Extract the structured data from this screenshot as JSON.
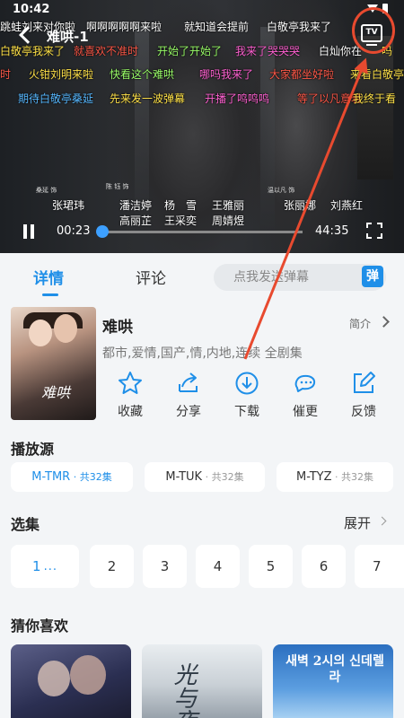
{
  "status_bar": {
    "time": "10:42"
  },
  "player": {
    "title": "难哄-1",
    "tv_label": "TV",
    "current_time": "00:23",
    "total_time": "44:35",
    "progress": 0.0086,
    "danmaku": [
      {
        "text": "跳蛙刘来对你啦",
        "color": "#ffffff"
      },
      {
        "text": "啊啊啊啊啊来啦",
        "color": "#ffffff"
      },
      {
        "text": "就知道会提前",
        "color": "#ffffff"
      },
      {
        "text": "白敬亭我来了",
        "color": "#ffffff"
      },
      {
        "text": "白敬亭我来了",
        "color": "#ffe24a"
      },
      {
        "text": "就喜欢不准时",
        "color": "#ff5a4a"
      },
      {
        "text": "开始了开始了",
        "color": "#9cff6b"
      },
      {
        "text": "我来了哭哭哭",
        "color": "#ff63d2"
      },
      {
        "text": "白灿你在",
        "color": "#ffffff"
      },
      {
        "text": "吗",
        "color": "#ffe24a"
      },
      {
        "text": "时",
        "color": "#ff5a4a"
      },
      {
        "text": "火钳刘明来啦",
        "color": "#ffe24a"
      },
      {
        "text": "快看这个难哄",
        "color": "#9cff6b"
      },
      {
        "text": "哪吗我来了",
        "color": "#ff63d2"
      },
      {
        "text": "大家都坐好啦",
        "color": "#ff5a4a"
      },
      {
        "text": "来看白敬亭",
        "color": "#ffe24a"
      },
      {
        "text": "期待白敬亭桑延",
        "color": "#58b8ff"
      },
      {
        "text": "先来发一波弹幕",
        "color": "#ffe24a"
      },
      {
        "text": "开播了鸣鸣鸣",
        "color": "#ff63d2"
      },
      {
        "text": "等了以凡意着",
        "color": "#ff5a4a"
      },
      {
        "text": "我终于看",
        "color": "#ffe24a"
      }
    ],
    "cast": [
      {
        "label": "桑延 饰",
        "name": "张珺玮"
      },
      {
        "label": "陈 钰 饰",
        "name": "潘洁婷"
      },
      {
        "label": "",
        "name": "杨　雪"
      },
      {
        "label": "",
        "name": "王雅丽"
      },
      {
        "label": "",
        "name": "高丽芷"
      },
      {
        "label": "",
        "name": "王采奕"
      },
      {
        "label": "",
        "name": "周婧煜"
      },
      {
        "label": "温以凡 饰",
        "name": "张丽娜"
      },
      {
        "label": "",
        "name": "刘燕红"
      }
    ]
  },
  "tabs": {
    "details": "详情",
    "comments": "评论"
  },
  "danmaku_input": {
    "placeholder": "点我发送弹幕",
    "send_label": "弹"
  },
  "info": {
    "cover_text": "难哄",
    "title": "难哄",
    "intro_label": "简介",
    "tags": "都市,爱情,国产,情,内地,连续 全剧集"
  },
  "actions": [
    {
      "icon": "star-icon",
      "label": "收藏"
    },
    {
      "icon": "share-icon",
      "label": "分享"
    },
    {
      "icon": "download-icon",
      "label": "下载"
    },
    {
      "icon": "bell-icon",
      "label": "催更"
    },
    {
      "icon": "edit-icon",
      "label": "反馈"
    }
  ],
  "sources": {
    "title": "播放源",
    "items": [
      {
        "name": "M-TMR",
        "count": " · 共32集",
        "active": true
      },
      {
        "name": "M-TUK",
        "count": " · 共32集",
        "active": false
      },
      {
        "name": "M-TYZ",
        "count": " · 共32集",
        "active": false
      }
    ]
  },
  "episodes": {
    "title": "选集",
    "expand_label": "展开",
    "items": [
      "1",
      "2",
      "3",
      "4",
      "5",
      "6",
      "7"
    ],
    "playing_marker": "..."
  },
  "recommend": {
    "title": "猜你喜欢",
    "items": [
      {
        "text": ""
      },
      {
        "text": "光与夜"
      },
      {
        "text": "새벽 2시의 신데렐라"
      }
    ]
  },
  "colors": {
    "accent": "#1f8fe8",
    "annotation": "#e84a2f"
  }
}
